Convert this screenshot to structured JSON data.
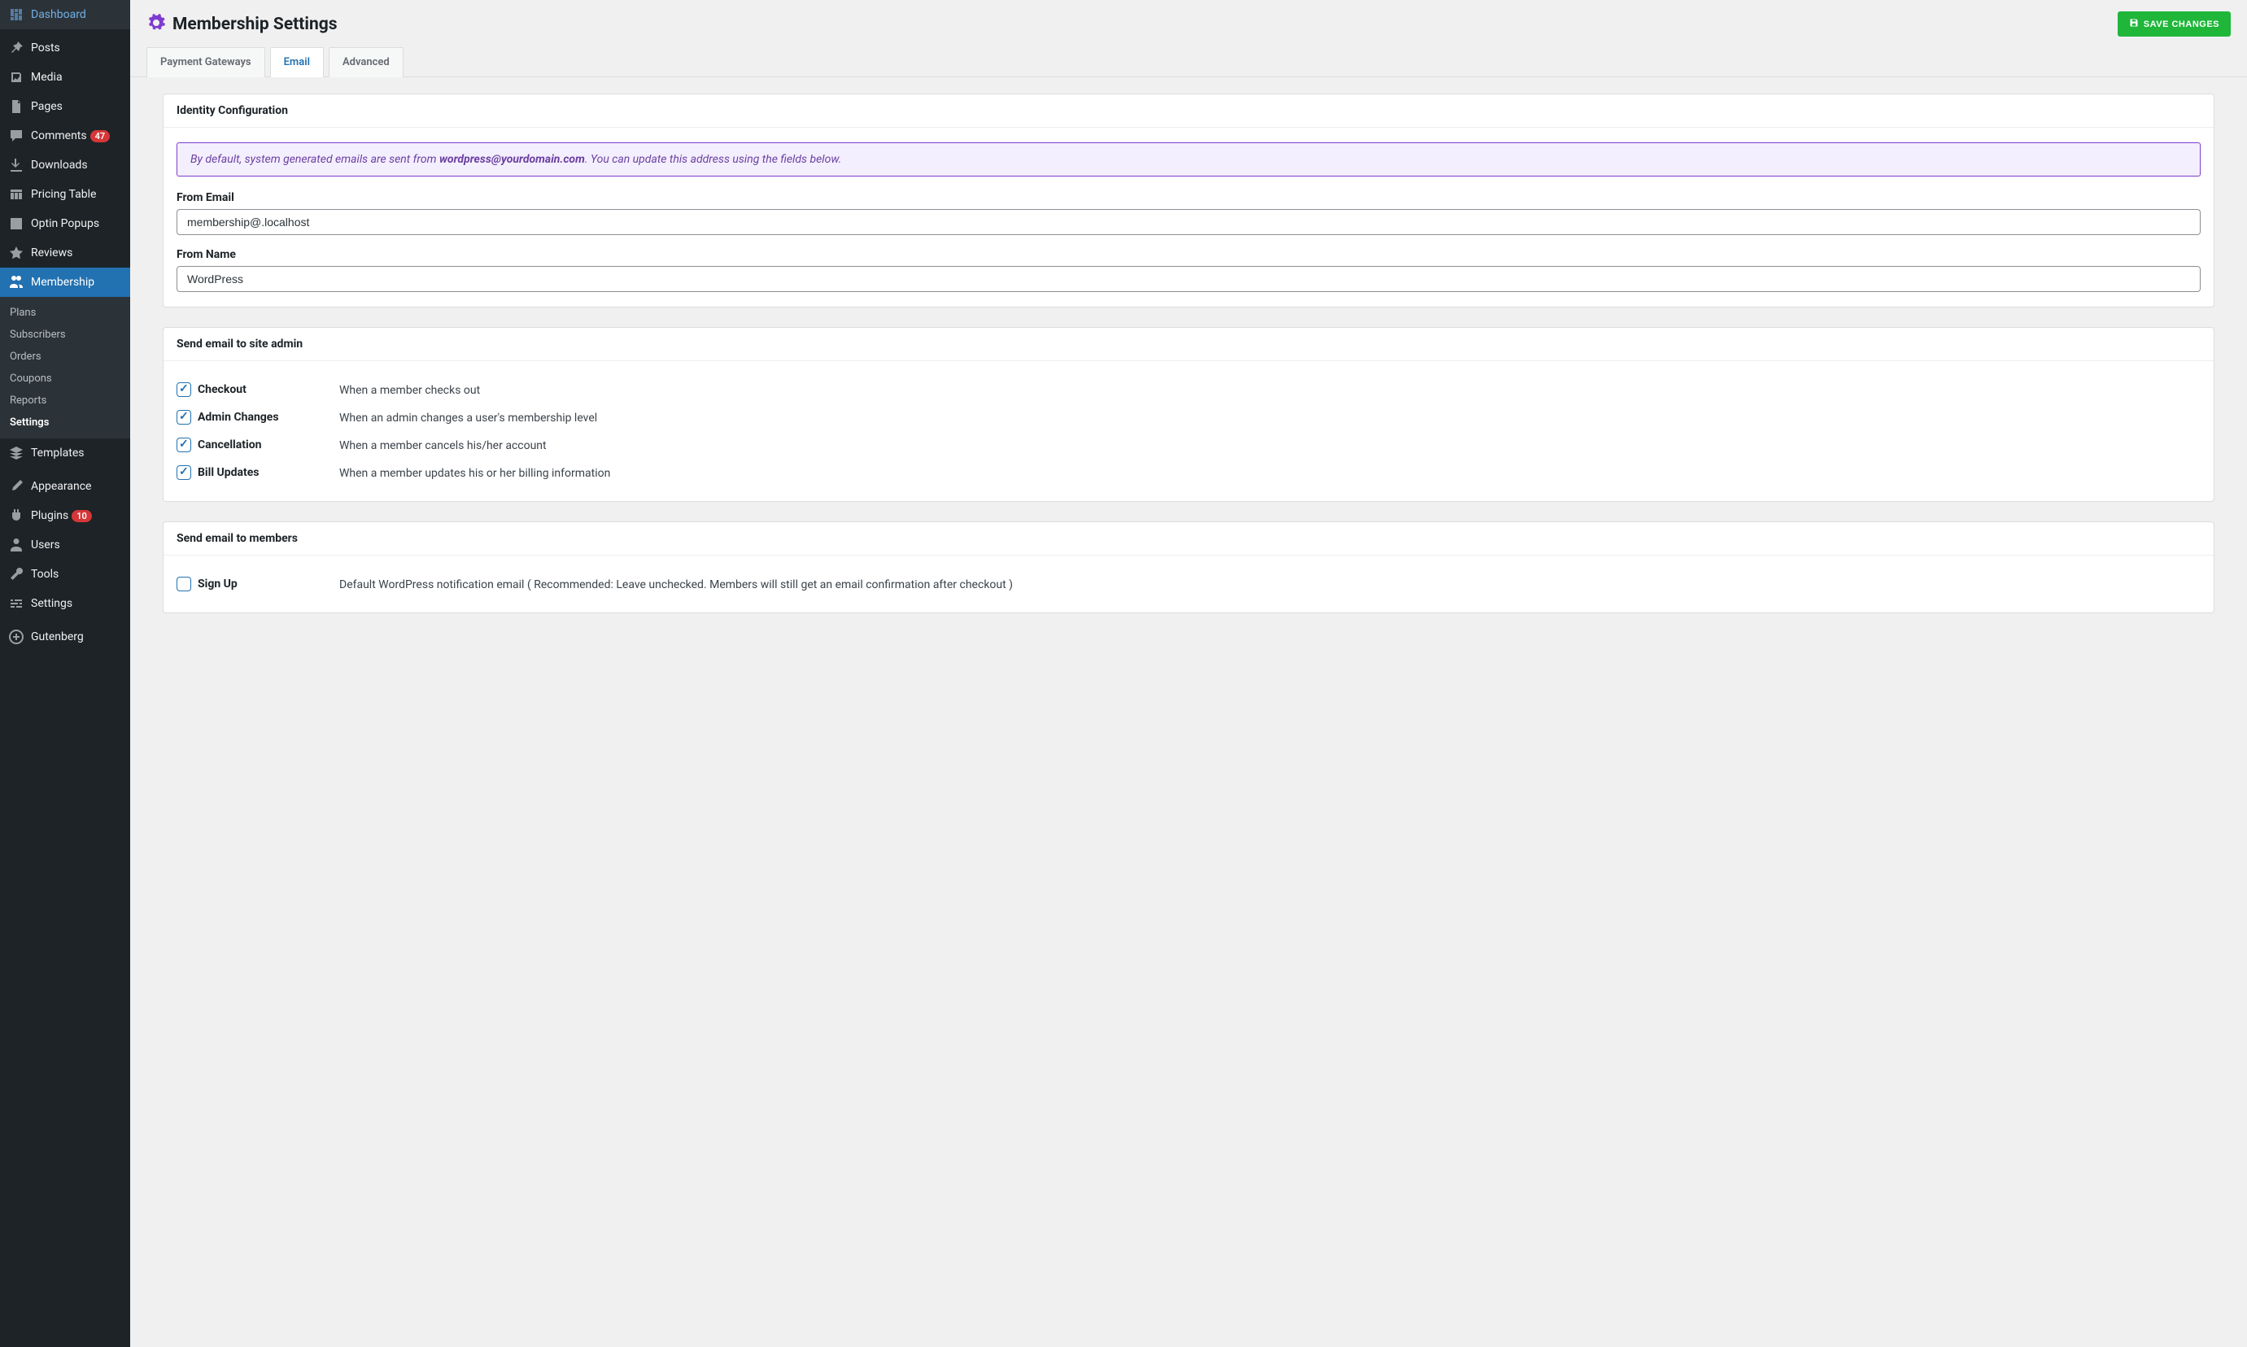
{
  "sidebar": {
    "items": [
      {
        "label": "Dashboard"
      },
      {
        "label": "Posts"
      },
      {
        "label": "Media"
      },
      {
        "label": "Pages"
      },
      {
        "label": "Comments",
        "badge": "47"
      },
      {
        "label": "Downloads"
      },
      {
        "label": "Pricing Table"
      },
      {
        "label": "Optin Popups"
      },
      {
        "label": "Reviews"
      },
      {
        "label": "Membership"
      },
      {
        "label": "Templates"
      },
      {
        "label": "Appearance"
      },
      {
        "label": "Plugins",
        "badge": "10"
      },
      {
        "label": "Users"
      },
      {
        "label": "Tools"
      },
      {
        "label": "Settings"
      },
      {
        "label": "Gutenberg"
      }
    ],
    "sub": [
      "Plans",
      "Subscribers",
      "Orders",
      "Coupons",
      "Reports",
      "Settings"
    ]
  },
  "header": {
    "title": "Membership Settings",
    "save": "SAVE CHANGES"
  },
  "tabs": [
    "Payment Gateways",
    "Email",
    "Advanced"
  ],
  "identity": {
    "title": "Identity Configuration",
    "notice_pre": "By default, system generated emails are sent from ",
    "notice_email": "wordpress@yourdomain.com",
    "notice_post": ". You can update this address using the fields below.",
    "from_email_label": "From Email",
    "from_email_value": "membership@.localhost",
    "from_name_label": "From Name",
    "from_name_value": "WordPress"
  },
  "admin_email": {
    "title": "Send email to site admin",
    "rows": [
      {
        "label": "Checkout",
        "desc": "When a member checks out",
        "checked": true
      },
      {
        "label": "Admin Changes",
        "desc": "When an admin changes a user's membership level",
        "checked": true
      },
      {
        "label": "Cancellation",
        "desc": "When a member cancels his/her account",
        "checked": true
      },
      {
        "label": "Bill Updates",
        "desc": "When a member updates his or her billing information",
        "checked": true
      }
    ]
  },
  "member_email": {
    "title": "Send email to members",
    "rows": [
      {
        "label": "Sign Up",
        "desc": "Default WordPress notification email ( Recommended: Leave unchecked. Members will still get an email confirmation after checkout )",
        "checked": false
      }
    ]
  }
}
